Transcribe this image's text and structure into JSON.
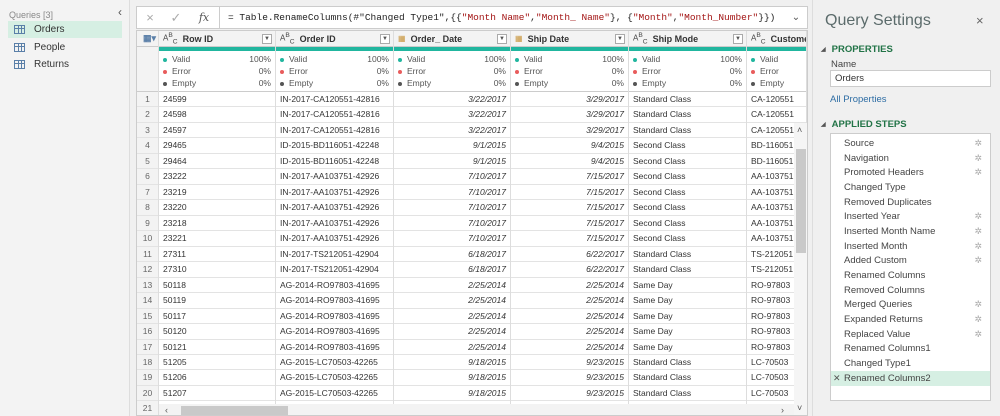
{
  "queries": {
    "header": "Queries [3]",
    "items": [
      {
        "label": "Orders",
        "selected": true
      },
      {
        "label": "People"
      },
      {
        "label": "Returns"
      }
    ]
  },
  "formula_bar": {
    "cancel_icon": "×",
    "confirm_icon": "✓",
    "fx": "fx",
    "formula_prefix": "= Table.RenameColumns(#\"Changed Type1\",{{",
    "s1": "\"Month Name\"",
    "sep1": ", ",
    "s2": "\"Month_ Name\"",
    "sep2": "}, {",
    "s3": "\"Month\"",
    "sep3": ", ",
    "s4": "\"Month_Number\"",
    "suffix": "}})"
  },
  "columns": [
    {
      "name": "Row ID",
      "type": "ABC",
      "valid": "100%",
      "error": "0%",
      "empty": "0%"
    },
    {
      "name": "Order ID",
      "type": "ABC",
      "valid": "100%",
      "error": "0%",
      "empty": "0%"
    },
    {
      "name": "Order_ Date",
      "type": "date",
      "valid": "100%",
      "error": "0%",
      "empty": "0%"
    },
    {
      "name": "Ship Date",
      "type": "date",
      "valid": "100%",
      "error": "0%",
      "empty": "0%"
    },
    {
      "name": "Ship Mode",
      "type": "ABC",
      "valid": "100%",
      "error": "0%",
      "empty": "0%"
    },
    {
      "name": "Customer ID",
      "type": "ABC",
      "valid": "Valid",
      "error": "Error",
      "empty": "Empty"
    }
  ],
  "quality_labels": {
    "valid": "Valid",
    "error": "Error",
    "empty": "Empty"
  },
  "colors": {
    "valid": "#21b69f",
    "error": "#e85c5c",
    "empty": "#555555",
    "accent": "#217346"
  },
  "rows": [
    [
      "24599",
      "IN-2017-CA120551-42816",
      "3/22/2017",
      "3/29/2017",
      "Standard Class",
      "CA-120551"
    ],
    [
      "24598",
      "IN-2017-CA120551-42816",
      "3/22/2017",
      "3/29/2017",
      "Standard Class",
      "CA-120551"
    ],
    [
      "24597",
      "IN-2017-CA120551-42816",
      "3/22/2017",
      "3/29/2017",
      "Standard Class",
      "CA-120551"
    ],
    [
      "29465",
      "ID-2015-BD116051-42248",
      "9/1/2015",
      "9/4/2015",
      "Second Class",
      "BD-116051"
    ],
    [
      "29464",
      "ID-2015-BD116051-42248",
      "9/1/2015",
      "9/4/2015",
      "Second Class",
      "BD-116051"
    ],
    [
      "23222",
      "IN-2017-AA103751-42926",
      "7/10/2017",
      "7/15/2017",
      "Second Class",
      "AA-103751"
    ],
    [
      "23219",
      "IN-2017-AA103751-42926",
      "7/10/2017",
      "7/15/2017",
      "Second Class",
      "AA-103751"
    ],
    [
      "23220",
      "IN-2017-AA103751-42926",
      "7/10/2017",
      "7/15/2017",
      "Second Class",
      "AA-103751"
    ],
    [
      "23218",
      "IN-2017-AA103751-42926",
      "7/10/2017",
      "7/15/2017",
      "Second Class",
      "AA-103751"
    ],
    [
      "23221",
      "IN-2017-AA103751-42926",
      "7/10/2017",
      "7/15/2017",
      "Second Class",
      "AA-103751"
    ],
    [
      "27311",
      "IN-2017-TS212051-42904",
      "6/18/2017",
      "6/22/2017",
      "Standard Class",
      "TS-212051"
    ],
    [
      "27310",
      "IN-2017-TS212051-42904",
      "6/18/2017",
      "6/22/2017",
      "Standard Class",
      "TS-212051"
    ],
    [
      "50118",
      "AG-2014-RO97803-41695",
      "2/25/2014",
      "2/25/2014",
      "Same Day",
      "RO-97803"
    ],
    [
      "50119",
      "AG-2014-RO97803-41695",
      "2/25/2014",
      "2/25/2014",
      "Same Day",
      "RO-97803"
    ],
    [
      "50117",
      "AG-2014-RO97803-41695",
      "2/25/2014",
      "2/25/2014",
      "Same Day",
      "RO-97803"
    ],
    [
      "50120",
      "AG-2014-RO97803-41695",
      "2/25/2014",
      "2/25/2014",
      "Same Day",
      "RO-97803"
    ],
    [
      "50121",
      "AG-2014-RO97803-41695",
      "2/25/2014",
      "2/25/2014",
      "Same Day",
      "RO-97803"
    ],
    [
      "51205",
      "AG-2015-LC70503-42265",
      "9/18/2015",
      "9/23/2015",
      "Standard Class",
      "LC-70503"
    ],
    [
      "51206",
      "AG-2015-LC70503-42265",
      "9/18/2015",
      "9/23/2015",
      "Standard Class",
      "LC-70503"
    ],
    [
      "51207",
      "AG-2015-LC70503-42265",
      "9/18/2015",
      "9/23/2015",
      "Standard Class",
      "LC-70503"
    ]
  ],
  "last_row_number": "21",
  "settings": {
    "title": "Query Settings",
    "close": "×",
    "properties_header": "PROPERTIES",
    "name_label": "Name",
    "name_value": "Orders",
    "all_properties": "All Properties",
    "applied_steps_header": "APPLIED STEPS",
    "steps": [
      {
        "label": "Source",
        "gear": true
      },
      {
        "label": "Navigation",
        "gear": true
      },
      {
        "label": "Promoted Headers",
        "gear": true
      },
      {
        "label": "Changed Type",
        "gear": false
      },
      {
        "label": "Removed Duplicates",
        "gear": false
      },
      {
        "label": "Inserted Year",
        "gear": true
      },
      {
        "label": "Inserted Month Name",
        "gear": true
      },
      {
        "label": "Inserted Month",
        "gear": true
      },
      {
        "label": "Added Custom",
        "gear": true
      },
      {
        "label": "Renamed Columns",
        "gear": false
      },
      {
        "label": "Removed Columns",
        "gear": false
      },
      {
        "label": "Merged Queries",
        "gear": true
      },
      {
        "label": "Expanded Returns",
        "gear": true
      },
      {
        "label": "Replaced Value",
        "gear": true
      },
      {
        "label": "Renamed Columns1",
        "gear": false
      },
      {
        "label": "Changed Type1",
        "gear": false
      },
      {
        "label": "Renamed Columns2",
        "gear": false,
        "selected": true
      }
    ]
  }
}
